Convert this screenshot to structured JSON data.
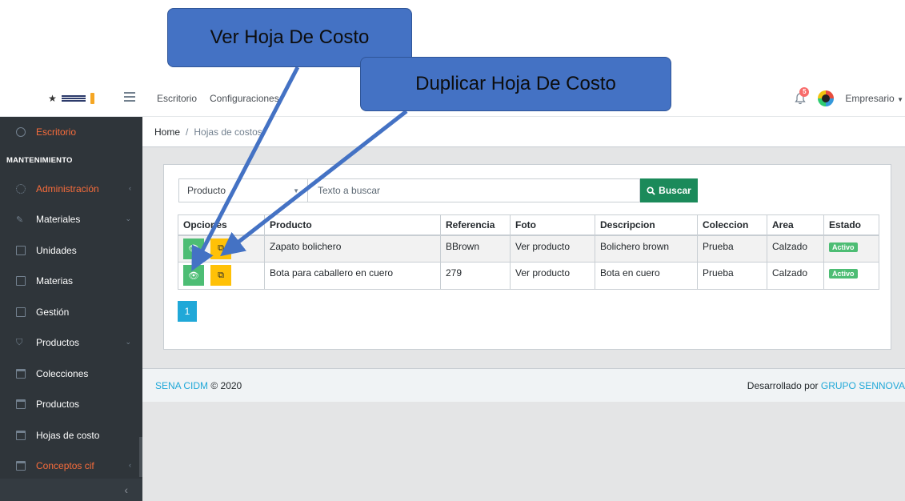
{
  "callouts": {
    "ver": "Ver Hoja De Costo",
    "duplicar": "Duplicar Hoja De Costo"
  },
  "header": {
    "nav": [
      "Escritorio",
      "Configuraciones"
    ],
    "notifications_count": "5",
    "user": "Empresario"
  },
  "sidebar": {
    "items": [
      {
        "label": "Escritorio"
      },
      {
        "label": "MANTENIMIENTO"
      },
      {
        "label": "Administración"
      },
      {
        "label": "Materiales"
      },
      {
        "label": "Unidades"
      },
      {
        "label": "Materias"
      },
      {
        "label": "Gestión"
      },
      {
        "label": "Productos"
      },
      {
        "label": "Colecciones"
      },
      {
        "label": "Productos"
      },
      {
        "label": "Hojas de costo"
      },
      {
        "label": "Conceptos cif"
      }
    ]
  },
  "breadcrumb": {
    "home": "Home",
    "current": "Hojas de costos"
  },
  "search": {
    "field": "Producto",
    "placeholder": "Texto a buscar",
    "button": "Buscar"
  },
  "table": {
    "headers": [
      "Opciones",
      "Producto",
      "Referencia",
      "Foto",
      "Descripcion",
      "Coleccion",
      "Area",
      "Estado"
    ],
    "rows": [
      {
        "producto": "Zapato bolichero",
        "referencia": "BBrown",
        "foto": "Ver producto",
        "descripcion": "Bolichero brown",
        "coleccion": "Prueba",
        "area": "Calzado",
        "estado": "Activo"
      },
      {
        "producto": "Bota para caballero en cuero",
        "referencia": "279",
        "foto": "Ver producto",
        "descripcion": "Bota en cuero",
        "coleccion": "Prueba",
        "area": "Calzado",
        "estado": "Activo"
      }
    ]
  },
  "pagination": {
    "page": "1"
  },
  "footer": {
    "left_link": "SENA CIDM",
    "left_text": "© 2020",
    "right_text": "Desarrollado por",
    "right_link": "GRUPO SENNOVA"
  },
  "colors": {
    "sidebar_bg": "#2f353a",
    "accent_active": "#f86c3b",
    "view_button": "#4dbd74",
    "duplicate_button": "#ffc107",
    "search_button": "#1b8a5a",
    "callout": "#4472c4"
  },
  "icons": {
    "view": "eye-icon",
    "duplicate": "copy-icon",
    "search": "search-icon",
    "notifications": "bell-icon",
    "collapse": "chevron-left-icon"
  }
}
